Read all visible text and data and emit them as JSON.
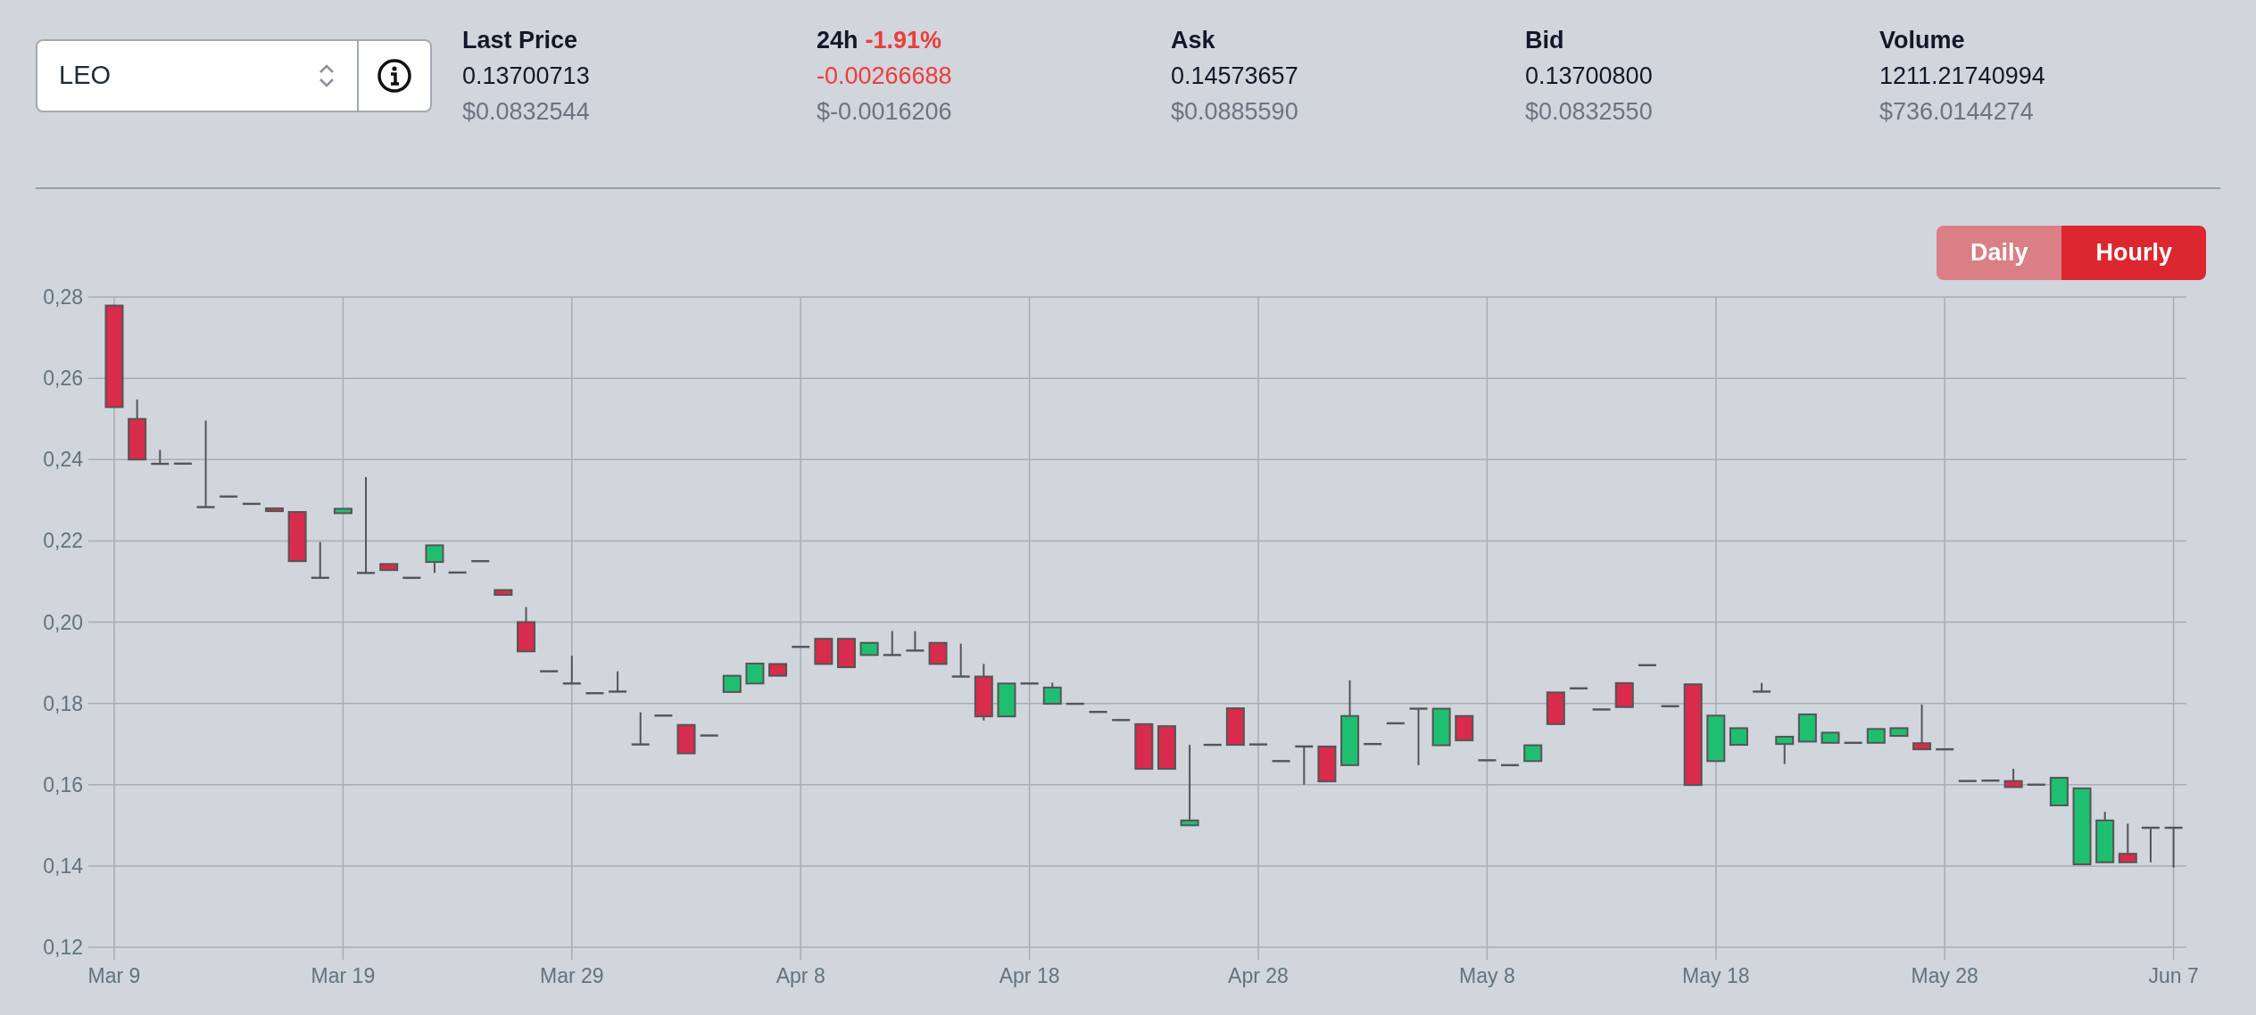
{
  "pair_select": {
    "value": "LEO"
  },
  "stats": [
    {
      "label": "Last Price",
      "value": "0.13700713",
      "negative": false,
      "fiat": "$0.0832544"
    },
    {
      "label": "24h",
      "label_change": "-1.91%",
      "value": "-0.00266688",
      "negative": true,
      "fiat": "$-0.0016206"
    },
    {
      "label": "Ask",
      "value": "0.14573657",
      "negative": false,
      "fiat": "$0.0885590"
    },
    {
      "label": "Bid",
      "value": "0.13700800",
      "negative": false,
      "fiat": "$0.0832550"
    },
    {
      "label": "Volume",
      "value": "1211.21740994",
      "negative": false,
      "fiat": "$736.0144274"
    }
  ],
  "interval_tabs": [
    {
      "label": "Daily",
      "selected": false
    },
    {
      "label": "Hourly",
      "selected": true
    }
  ],
  "price_chart": {
    "y_axis_labels": [
      "0,28",
      "0,26",
      "0,24",
      "0,22",
      "0,20",
      "0,18",
      "0,16",
      "0,14",
      "0,12"
    ],
    "x_axis_labels": [
      "Mar 9",
      "Mar 19",
      "Mar 29",
      "Apr 8",
      "Apr 18",
      "Apr 28",
      "May 8",
      "May 18",
      "May 28",
      "Jun 7"
    ]
  }
}
